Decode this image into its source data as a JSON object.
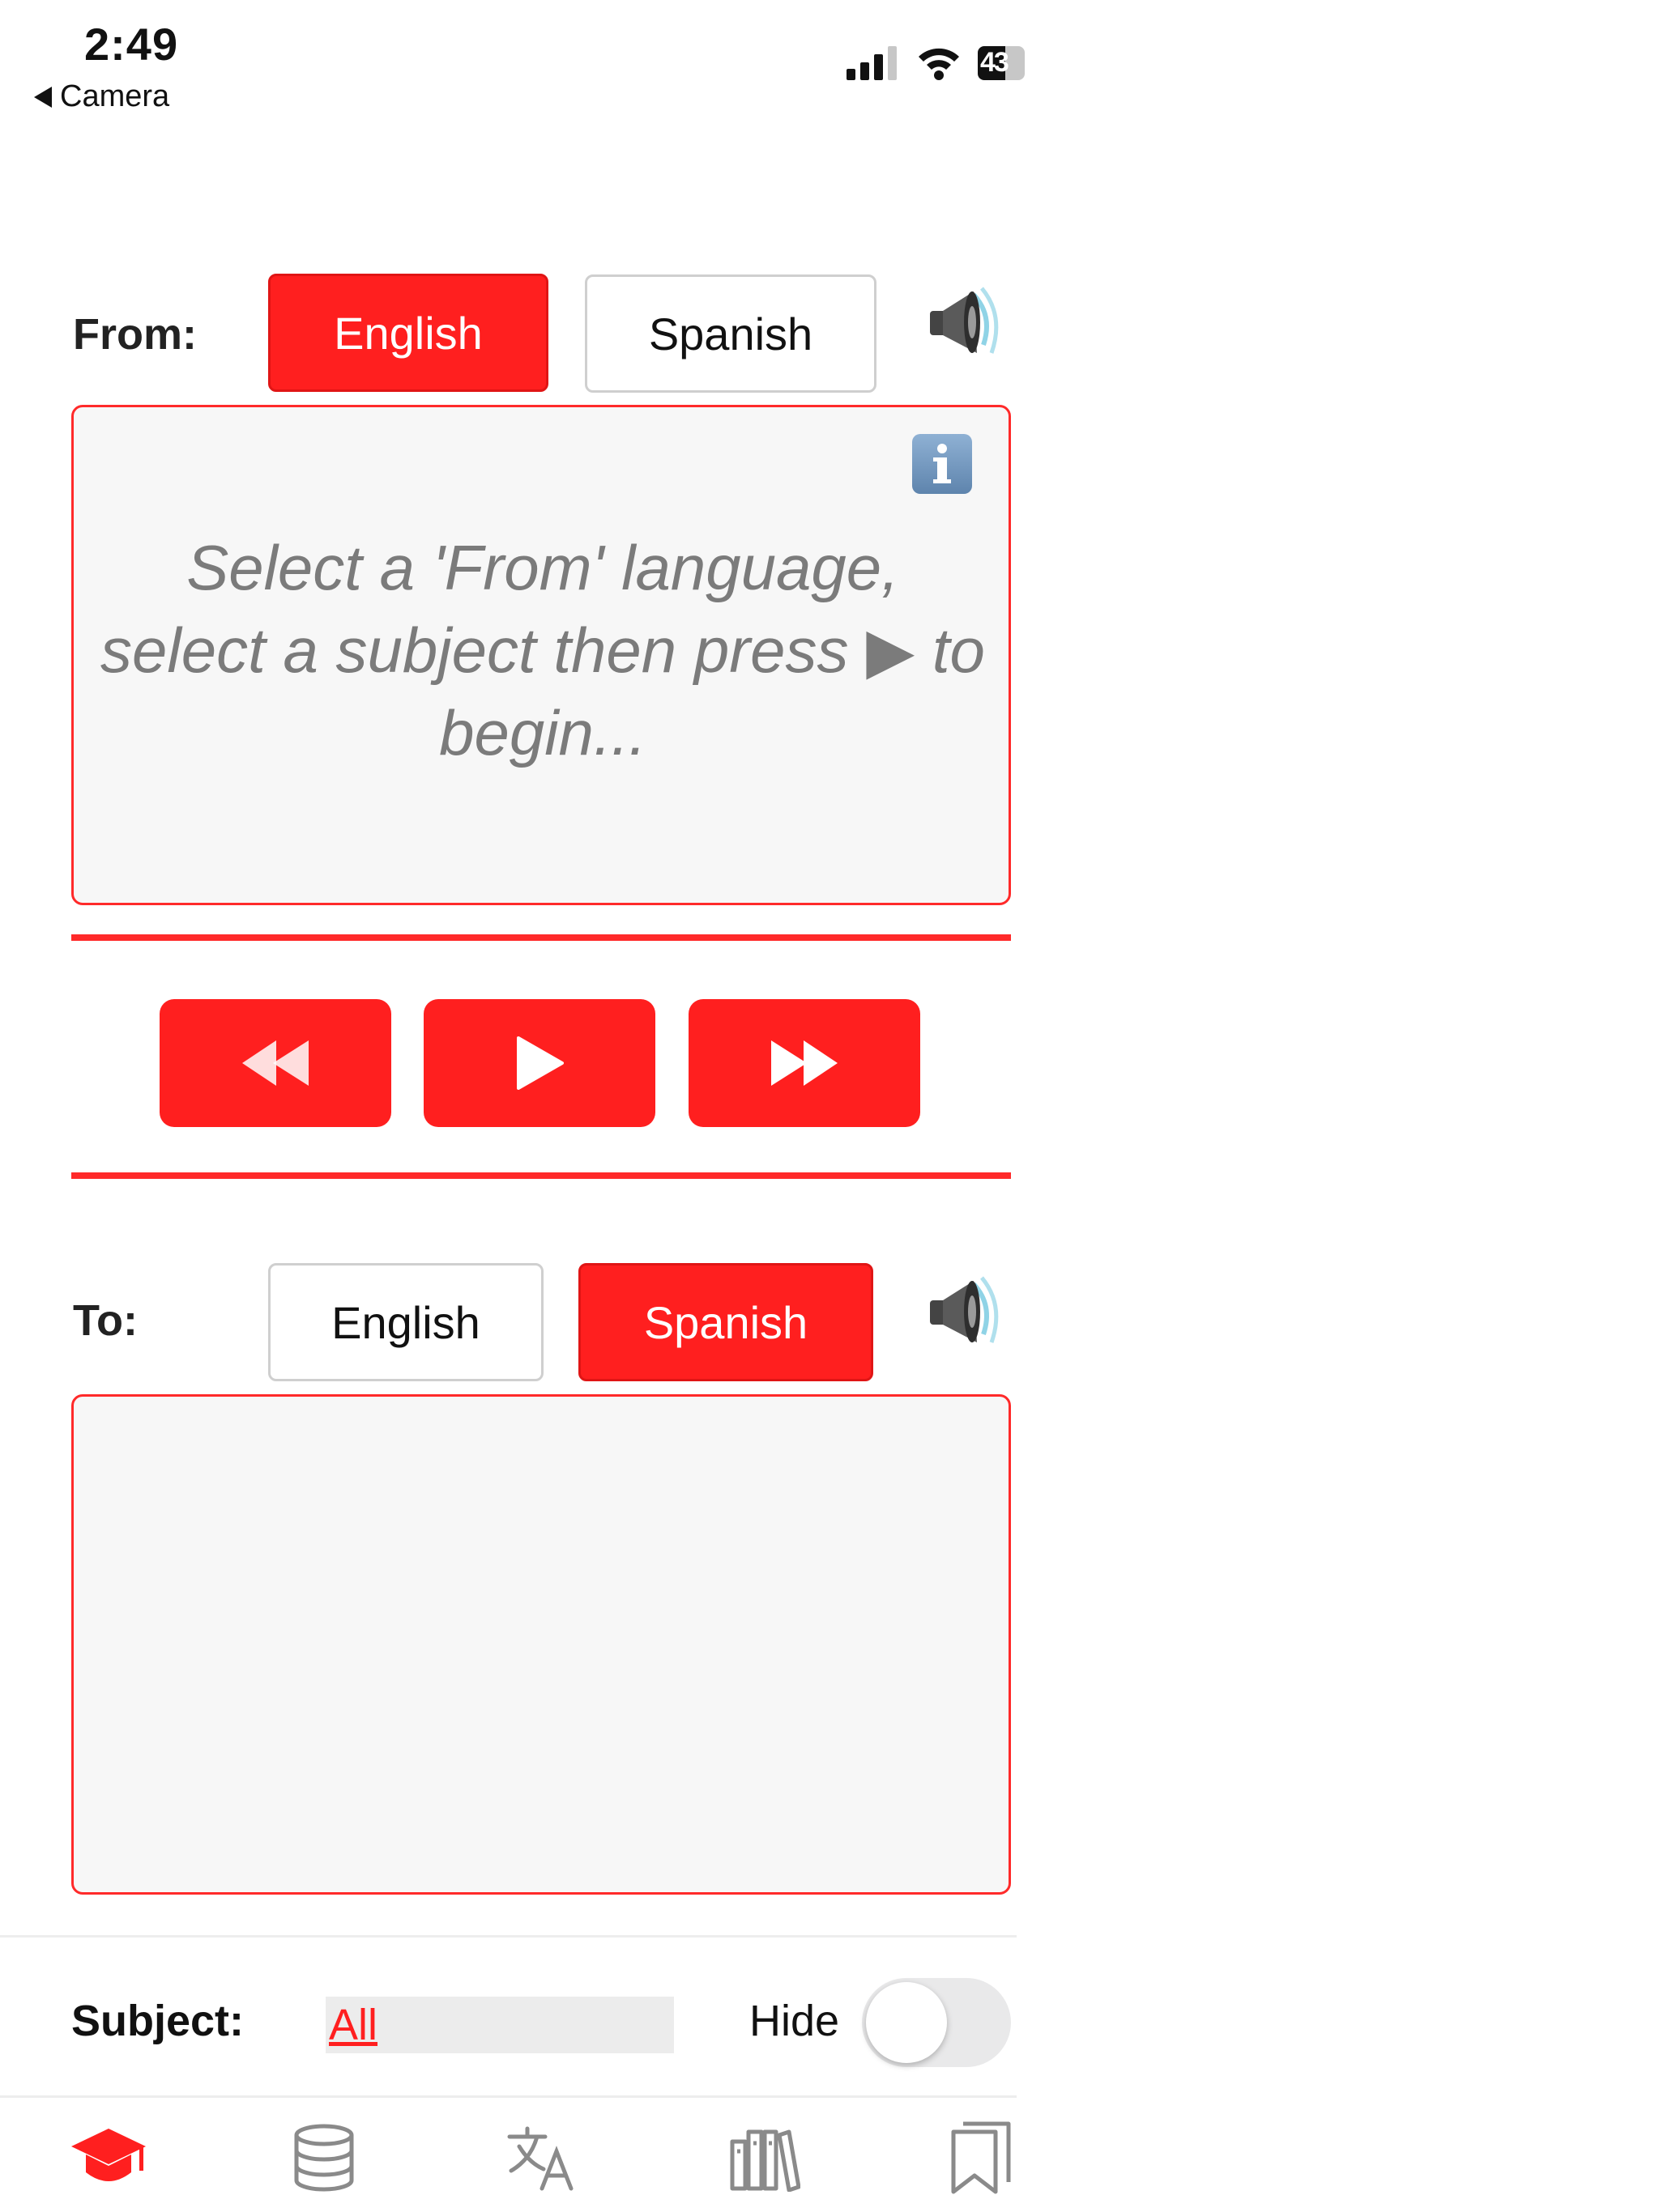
{
  "status_bar": {
    "time": "2:49",
    "back_label": "Camera",
    "battery": "43"
  },
  "from_section": {
    "label": "From:",
    "languages": [
      "English",
      "Spanish"
    ],
    "selected": "English",
    "placeholder": "Select a 'From' language, select a subject then press ▶ to begin..."
  },
  "to_section": {
    "label": "To:",
    "languages": [
      "English",
      "Spanish"
    ],
    "selected": "Spanish",
    "text": ""
  },
  "subject": {
    "label": "Subject:",
    "value": "All"
  },
  "hide": {
    "label": "Hide",
    "on": false
  },
  "colors": {
    "accent": "#ff1f1f",
    "box_border": "#ff2a2a",
    "box_bg": "#f7f7f7",
    "tab_inactive": "#8a8a8a"
  },
  "tab_bar": {
    "items": [
      "graduation-cap-icon",
      "database-icon",
      "translate-icon",
      "library-icon",
      "bookmark-icon"
    ],
    "selected_index": 0
  }
}
